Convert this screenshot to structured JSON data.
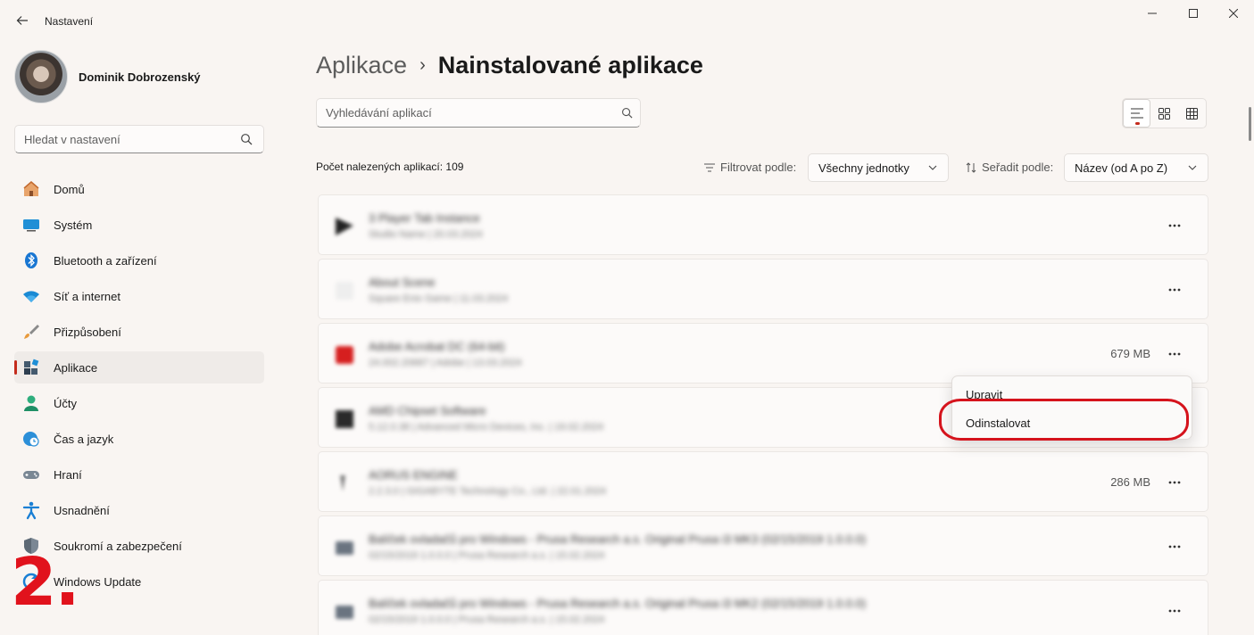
{
  "window": {
    "title": "Nastavení"
  },
  "profile": {
    "name": "Dominik Dobrozenský"
  },
  "sidebar": {
    "search_placeholder": "Hledat v nastavení",
    "items": [
      {
        "label": "Domů",
        "icon": "home-icon"
      },
      {
        "label": "Systém",
        "icon": "system-icon"
      },
      {
        "label": "Bluetooth a zařízení",
        "icon": "bluetooth-icon"
      },
      {
        "label": "Síť a internet",
        "icon": "wifi-icon"
      },
      {
        "label": "Přizpůsobení",
        "icon": "brush-icon"
      },
      {
        "label": "Aplikace",
        "icon": "apps-icon",
        "active": true
      },
      {
        "label": "Účty",
        "icon": "account-icon"
      },
      {
        "label": "Čas a jazyk",
        "icon": "clock-globe-icon"
      },
      {
        "label": "Hraní",
        "icon": "gamepad-icon"
      },
      {
        "label": "Usnadnění",
        "icon": "accessibility-icon"
      },
      {
        "label": "Soukromí a zabezpečení",
        "icon": "shield-icon"
      },
      {
        "label": "Windows Update",
        "icon": "update-icon"
      }
    ]
  },
  "annotation": {
    "step": "2."
  },
  "main": {
    "breadcrumb": {
      "parent": "Aplikace",
      "separator": "›",
      "current": "Nainstalované aplikace"
    },
    "search_placeholder": "Vyhledávání aplikací",
    "count_text": "Počet nalezených aplikací: 109",
    "filter": {
      "label": "Filtrovat podle:",
      "value": "Všechny jednotky"
    },
    "sort": {
      "label": "Seřadit podle:",
      "value": "Název (od A po Z)"
    },
    "apps": [
      {
        "name": "3 Player Tab Instance",
        "meta": "Studio Name  |  20.03.2024",
        "size": "",
        "icon_color": "#222222"
      },
      {
        "name": "About Scene",
        "meta": "Square Enix Game  |  11.03.2024",
        "size": "",
        "icon_color": "#eeeeee"
      },
      {
        "name": "Adobe Acrobat DC (64-bit)",
        "meta": "24.002.20687  |  Adobe  |  13.03.2024",
        "size": "679 MB",
        "icon_color": "#d61f1f"
      },
      {
        "name": "AMD Chipset Software",
        "meta": "5.12.0.38  |  Advanced Micro Devices, Inc.  |  19.02.2024",
        "size": "",
        "icon_color": "#2a2a2a"
      },
      {
        "name": "AORUS ENGINE",
        "meta": "2.2.3.0  |  GIGABYTE Technology Co., Ltd.  |  22.01.2024",
        "size": "286 MB",
        "icon_color": "#777777"
      },
      {
        "name": "Balíček ovladačů pro Windows - Prusa Research a.s. Original Prusa i3 MK3 (02/15/2019 1.0.0.0)",
        "meta": "02/15/2019 1.0.0.0  |  Prusa Research a.s.  |  15.02.2024",
        "size": "",
        "icon_color": "#6a7480"
      },
      {
        "name": "Balíček ovladačů pro Windows - Prusa Research a.s. Original Prusa i3 MK2 (02/15/2019 1.0.0.0)",
        "meta": "02/15/2019 1.0.0.0  |  Prusa Research a.s.  |  15.02.2024",
        "size": "",
        "icon_color": "#6a7480"
      }
    ],
    "context_menu": [
      "Upravit",
      "Odinstalovat"
    ]
  }
}
